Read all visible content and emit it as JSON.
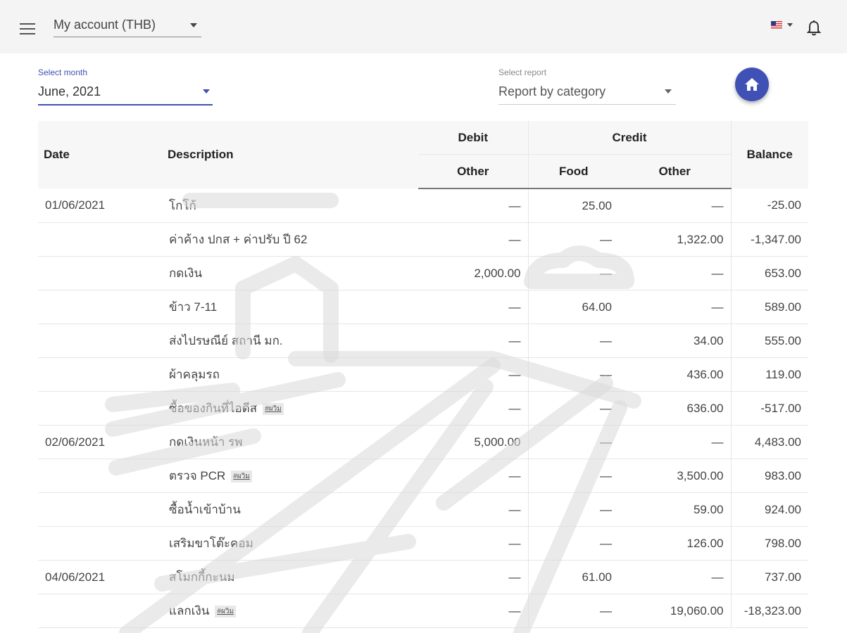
{
  "header": {
    "account_label": "My account (THB)"
  },
  "controls": {
    "month_label": "Select month",
    "month_value": "June, 2021",
    "report_label": "Select report",
    "report_value": "Report by category"
  },
  "table": {
    "headers": {
      "date": "Date",
      "description": "Description",
      "debit": "Debit",
      "credit": "Credit",
      "balance": "Balance",
      "debit_other": "Other",
      "credit_food": "Food",
      "credit_other": "Other"
    },
    "rows": [
      {
        "date": "01/06/2021",
        "desc": "โกโก้",
        "tag": "",
        "debit_other": "—",
        "credit_food": "25.00",
        "credit_other": "—",
        "balance": "-25.00"
      },
      {
        "date": "",
        "desc": "ค่าค้าง ปกส + ค่าปรับ ปี 62",
        "tag": "",
        "debit_other": "—",
        "credit_food": "—",
        "credit_other": "1,322.00",
        "balance": "-1,347.00"
      },
      {
        "date": "",
        "desc": "กดเงิน",
        "tag": "",
        "debit_other": "2,000.00",
        "credit_food": "—",
        "credit_other": "—",
        "balance": "653.00"
      },
      {
        "date": "",
        "desc": "ข้าว 7-11",
        "tag": "",
        "debit_other": "—",
        "credit_food": "64.00",
        "credit_other": "—",
        "balance": "589.00"
      },
      {
        "date": "",
        "desc": "ส่งไปรษณีย์ สถานี มก.",
        "tag": "",
        "debit_other": "—",
        "credit_food": "—",
        "credit_other": "34.00",
        "balance": "555.00"
      },
      {
        "date": "",
        "desc": "ผ้าคลุมรถ",
        "tag": "",
        "debit_other": "—",
        "credit_food": "—",
        "credit_other": "436.00",
        "balance": "119.00"
      },
      {
        "date": "",
        "desc": "ซื้อของกินที่ไอดีส",
        "tag": "#ผวิม",
        "debit_other": "—",
        "credit_food": "—",
        "credit_other": "636.00",
        "balance": "-517.00"
      },
      {
        "date": "02/06/2021",
        "desc": "กดเงินหน้า รพ",
        "tag": "",
        "debit_other": "5,000.00",
        "credit_food": "—",
        "credit_other": "—",
        "balance": "4,483.00"
      },
      {
        "date": "",
        "desc": "ตรวจ PCR",
        "tag": "#ผวิม",
        "debit_other": "—",
        "credit_food": "—",
        "credit_other": "3,500.00",
        "balance": "983.00"
      },
      {
        "date": "",
        "desc": "ซื้อน้ำเข้าบ้าน",
        "tag": "",
        "debit_other": "—",
        "credit_food": "—",
        "credit_other": "59.00",
        "balance": "924.00"
      },
      {
        "date": "",
        "desc": "เสริมขาโต๊ะคอม",
        "tag": "",
        "debit_other": "—",
        "credit_food": "—",
        "credit_other": "126.00",
        "balance": "798.00"
      },
      {
        "date": "04/06/2021",
        "desc": "สโมกกี้กะนม",
        "tag": "",
        "debit_other": "—",
        "credit_food": "61.00",
        "credit_other": "—",
        "balance": "737.00"
      },
      {
        "date": "",
        "desc": "แลกเงิน",
        "tag": "#ผวิม",
        "debit_other": "—",
        "credit_food": "—",
        "credit_other": "19,060.00",
        "balance": "-18,323.00"
      }
    ]
  },
  "colors": {
    "accent": "#3f51b5",
    "topbar": "#f4f4f4",
    "header_bg": "#f7f7f8"
  },
  "icons": [
    "menu-icon",
    "chevron-down-icon",
    "us-flag-icon",
    "bell-icon",
    "home-icon"
  ]
}
